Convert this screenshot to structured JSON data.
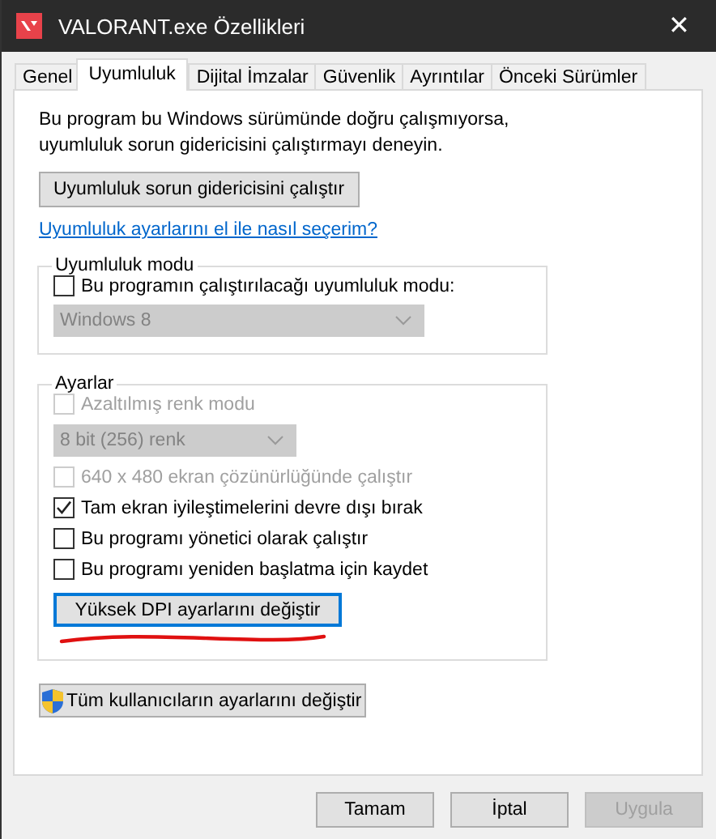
{
  "window": {
    "title": "VALORANT.exe Özellikleri",
    "close": "✕"
  },
  "tabs": [
    {
      "label": "Genel",
      "selected": false
    },
    {
      "label": "Uyumluluk",
      "selected": true
    },
    {
      "label": "Dijital İmzalar",
      "selected": false
    },
    {
      "label": "Güvenlik",
      "selected": false
    },
    {
      "label": "Ayrıntılar",
      "selected": false
    },
    {
      "label": "Önceki Sürümler",
      "selected": false
    }
  ],
  "intro": "Bu program bu Windows sürümünde doğru çalışmıyorsa, uyumluluk sorun gidericisini çalıştırmayı deneyin.",
  "troubleshooter_button": "Uyumluluk sorun gidericisini çalıştır",
  "help_link": "Uyumluluk ayarlarını el ile nasıl seçerim?",
  "compat_group": {
    "title": "Uyumluluk modu",
    "items": [
      {
        "kind": "checkbox",
        "label": "Bu programın çalıştırılacağı uyumluluk modu:",
        "checked": false,
        "disabled": false
      },
      {
        "kind": "dropdown",
        "value": "Windows 8",
        "disabled": true,
        "wide": true
      }
    ]
  },
  "settings_group": {
    "title": "Ayarlar",
    "items": [
      {
        "kind": "checkbox",
        "label": "Azaltılmış renk modu",
        "checked": false,
        "disabled": true
      },
      {
        "kind": "dropdown",
        "value": "8 bit (256) renk",
        "disabled": true,
        "wide": false
      },
      {
        "kind": "checkbox",
        "label": "640 x 480 ekran çözünürlüğünde çalıştır",
        "checked": false,
        "disabled": true
      },
      {
        "kind": "checkbox",
        "label": "Tam ekran iyileştimelerini devre dışı bırak",
        "checked": true,
        "disabled": false
      },
      {
        "kind": "checkbox",
        "label": "Bu programı yönetici olarak çalıştır",
        "checked": false,
        "disabled": false
      },
      {
        "kind": "checkbox",
        "label": "Bu programı yeniden başlatma için kaydet",
        "checked": false,
        "disabled": false
      }
    ],
    "dpi_button": {
      "label": "Yüksek DPI ayarlarını değiştir",
      "focused": true
    }
  },
  "all_users_button": "Tüm kullanıcıların ayarlarını değiştir",
  "buttons": [
    {
      "label": "Tamam",
      "disabled": false
    },
    {
      "label": "İptal",
      "disabled": false
    },
    {
      "label": "Uygula",
      "disabled": true
    }
  ]
}
